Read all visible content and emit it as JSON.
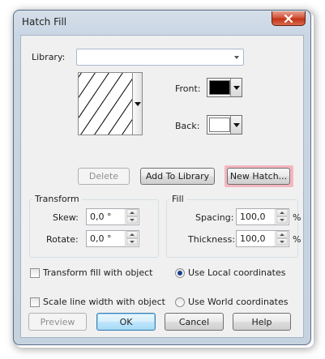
{
  "window": {
    "title": "Hatch Fill",
    "close_icon": "close-icon"
  },
  "library": {
    "label": "Library:",
    "value": ""
  },
  "preview": {
    "pattern_icon": "diagonal-hatch-icon"
  },
  "colors": {
    "front_label": "Front:",
    "front_color": "#000000",
    "back_label": "Back:",
    "back_color": "#ffffff"
  },
  "actions": {
    "delete": "Delete",
    "add_to_library": "Add To Library",
    "new_hatch": "New Hatch..."
  },
  "transform": {
    "title": "Transform",
    "skew_label": "Skew:",
    "skew_value": "0,0 °",
    "rotate_label": "Rotate:",
    "rotate_value": "0,0 °"
  },
  "fill": {
    "title": "Fill",
    "spacing_label": "Spacing:",
    "spacing_value": "100,0",
    "spacing_unit": "%",
    "thickness_label": "Thickness:",
    "thickness_value": "100,0",
    "thickness_unit": "%"
  },
  "options": {
    "transform_fill": "Transform fill with object",
    "transform_fill_checked": false,
    "scale_line": "Scale line width with object",
    "scale_line_checked": false,
    "local_coords": "Use Local coordinates",
    "world_coords": "Use World coordinates",
    "selected_coords": "local"
  },
  "footer": {
    "preview": "Preview",
    "ok": "OK",
    "cancel": "Cancel",
    "help": "Help"
  },
  "accent": {
    "highlight": "#f4b7bf",
    "close_red": "#c23418"
  }
}
